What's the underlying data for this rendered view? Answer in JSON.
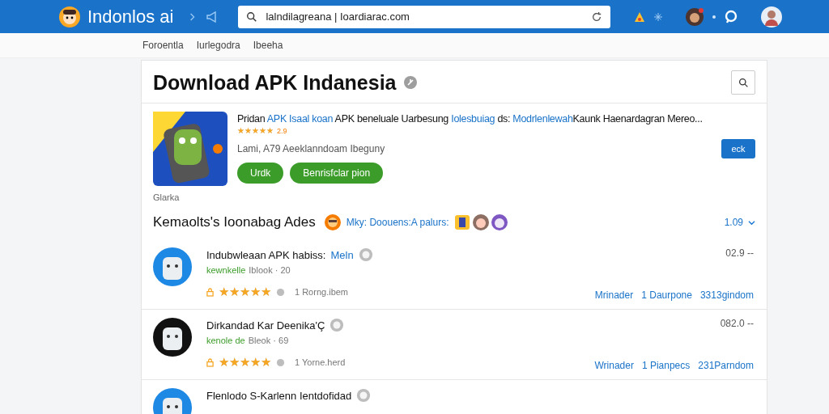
{
  "topbar": {
    "brand": "Indonlos ai",
    "search": {
      "value": "lalndilagreana | Ioardiarac.com"
    }
  },
  "nav": [
    "Foroentla",
    "Iurlegodra",
    "Ibeeha"
  ],
  "page": {
    "title": "Download APK Indanesia"
  },
  "featured": {
    "description": [
      {
        "text": "Pridan ",
        "highlight": false
      },
      {
        "text": "APK Isaal koan",
        "highlight": true
      },
      {
        "text": " APK beneluale Uarbesung ",
        "highlight": false
      },
      {
        "text": "Iolesbuiag",
        "highlight": true
      },
      {
        "text": " ds: ",
        "highlight": false
      },
      {
        "text": "Modrlenlewah",
        "highlight": true
      },
      {
        "text": "Kaunk Haenardagran Mereo...",
        "highlight": false
      }
    ],
    "stars": 5,
    "rating": "2.9",
    "meta": "Lami, A79  Aeeklanndoam Ibeguny",
    "buttons": [
      {
        "label": "Urdk"
      },
      {
        "label": "Benrisfclar pion"
      }
    ],
    "side_button": "eck",
    "caption": "Glarka"
  },
  "section": {
    "title": "Kemaolts's Ioonabag Ades",
    "note": "Mky: Doouens:A palurs:",
    "count": "1.09"
  },
  "apps": [
    {
      "title": "Indubwleaan APK habiss:",
      "title_extra": "Meln",
      "tag": "kewnkelle",
      "sub": "Iblook · 20",
      "stars": 5,
      "reviews": "1 Rorng.ibem",
      "version": "02.9 --",
      "links": [
        "Mrinader",
        "1 Daurpone",
        "3313gindom"
      ]
    },
    {
      "title": "Dirkandad Kar Deenika'Ç",
      "tag": "kenole de",
      "sub": "Bleok · 69",
      "stars": 5,
      "reviews": "1 Yorne.herd",
      "version": "082.0 --",
      "links": [
        "Wrinader",
        "1 Pianpecs",
        "231Parndom"
      ]
    },
    {
      "title": "Flenlodo S-Karlenn Ientdofidad"
    }
  ]
}
